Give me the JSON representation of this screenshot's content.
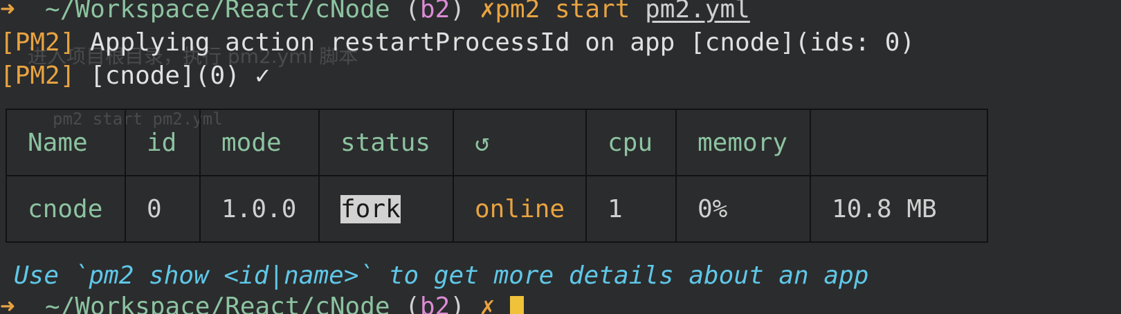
{
  "prompt": {
    "arrow": "➜",
    "path": "~/Workspace/React/cNode",
    "branch_open": "(",
    "branch": "b2",
    "branch_close": ")",
    "dirty": "✗",
    "command": "pm2 start ",
    "command_arg": "pm2.yml"
  },
  "output": {
    "line1_tag": "[PM2]",
    "line1_text": " Applying action restartProcessId on app [cnode](ids: 0)",
    "line2_tag": "[PM2]",
    "line2_text": " [cnode](0) ✓"
  },
  "ghost_overlay": {
    "line_a": "进入项目根目录，执行 pm2.yml 脚本",
    "line_b": "pm2 start pm2.yml"
  },
  "table": {
    "headers": [
      "Name",
      "id",
      "mode",
      "status",
      "↺",
      "cpu",
      "memory",
      ""
    ],
    "row": {
      "name": "cnode",
      "id": "0",
      "version": "1.0.0",
      "mode": "fork",
      "status": "online",
      "restarts": "1",
      "cpu": "0%",
      "memory": "10.8 MB"
    }
  },
  "hint": "Use `pm2 show <id|name>` to get more details about an app",
  "next_prompt": {
    "arrow": "➜",
    "path": "~/Workspace/React/cNode",
    "branch_open": "(",
    "branch": "b2",
    "branch_close": ")",
    "dirty": "✗"
  },
  "colors": {
    "background": "#2b2c2d",
    "prompt_arrow": "#e8a341",
    "path": "#8cc3a1",
    "branch": "#dc8bd6",
    "status_online": "#e8a341",
    "hint": "#5fc7e8",
    "cursor": "#f0c23a"
  }
}
